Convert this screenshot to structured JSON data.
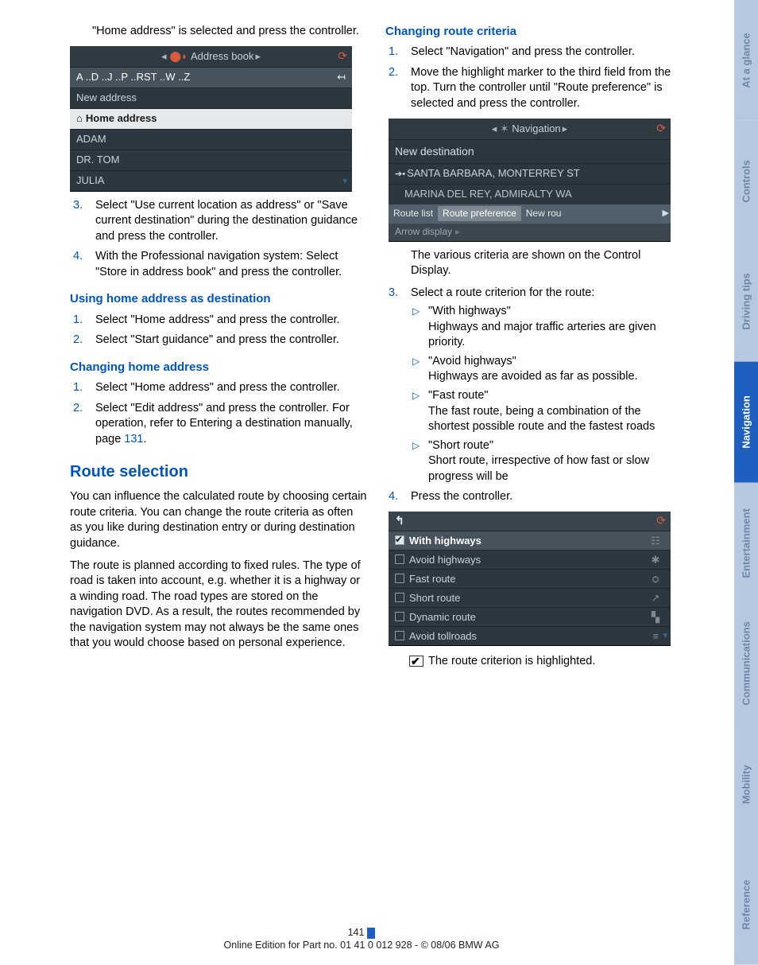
{
  "leftCol": {
    "leadIn": "\"Home address\" is selected and press the controller.",
    "ss1": {
      "title": "Address book",
      "alpha": "A ..D ..J ..P ..RST ..W ..Z",
      "newAddress": "New address",
      "homeAddress": "Home address",
      "rows": [
        "ADAM",
        "DR. TOM",
        "JULIA"
      ]
    },
    "step3": "Select \"Use current location as address\" or \"Save current destination\" during the destination guidance and press the controller.",
    "step4": "With the Professional navigation system: Select \"Store in address book\" and press the controller.",
    "h_useHome": "Using home address as destination",
    "useHome_s1": "Select \"Home address\" and press the controller.",
    "useHome_s2": "Select \"Start guidance\" and press the controller.",
    "h_changeHome": "Changing home address",
    "changeHome_s1": "Select \"Home address\" and press the controller.",
    "changeHome_s2_a": "Select \"Edit address\" and press the controller. For operation, refer to Entering a destination manually, page ",
    "changeHome_s2_page": "131",
    "changeHome_s2_b": ".",
    "h_routeSel": "Route selection",
    "routeSel_p1": "You can influence the calculated route by choosing certain route criteria. You can change the route criteria as often as you like during destination entry or during destination guidance.",
    "routeSel_p2": "The route is planned according to fixed rules. The type of road is taken into account, e.g. whether it is a highway or a winding road. The road types are stored on the navigation DVD. As a result, the routes recommended by the navigation system may not always be the same ones that you would choose based on personal experience."
  },
  "rightCol": {
    "h_changeCrit": "Changing route criteria",
    "cc_s1": "Select \"Navigation\" and press the controller.",
    "cc_s2": "Move the highlight marker to the third field from the top. Turn the controller until \"Route preference\" is selected and press the controller.",
    "ss2": {
      "title": "Navigation",
      "newDest": "New destination",
      "dest1": "SANTA BARBARA, MONTERREY ST",
      "dest2": "MARINA DEL REY, ADMIRALTY WA",
      "tab1": "Route list",
      "tab2": "Route preference",
      "tab3": "New rou",
      "arrow": "Arrow display"
    },
    "cc_after2": "The various criteria are shown on the Control Display.",
    "cc_s3": "Select a route criterion for the route:",
    "crit": [
      {
        "name": "\"With highways\"",
        "desc": "Highways and major traffic arteries are given priority."
      },
      {
        "name": "\"Avoid highways\"",
        "desc": "Highways are avoided as far as possible."
      },
      {
        "name": "\"Fast route\"",
        "desc": "The fast route, being a combination of the shortest possible route and the fastest roads"
      },
      {
        "name": "\"Short route\"",
        "desc": "Short route, irrespective of how fast or slow progress will be"
      }
    ],
    "cc_s4": "Press the controller.",
    "ss3": {
      "rows": [
        {
          "checked": true,
          "label": "With highways",
          "icon": "☷"
        },
        {
          "checked": false,
          "label": "Avoid highways",
          "icon": "✱"
        },
        {
          "checked": false,
          "label": "Fast route",
          "icon": "ѻ"
        },
        {
          "checked": false,
          "label": "Short route",
          "icon": "↗"
        },
        {
          "checked": false,
          "label": "Dynamic route",
          "icon": "▚"
        },
        {
          "checked": false,
          "label": "Avoid tollroads",
          "icon": "≡"
        }
      ]
    },
    "final": "The route criterion is highlighted."
  },
  "sideTabs": [
    "At a glance",
    "Controls",
    "Driving tips",
    "Navigation",
    "Entertainment",
    "Communications",
    "Mobility",
    "Reference"
  ],
  "activeTab": "Navigation",
  "footer": {
    "page": "141",
    "line": "Online Edition for Part no. 01 41 0 012 928 - © 08/06 BMW AG"
  }
}
